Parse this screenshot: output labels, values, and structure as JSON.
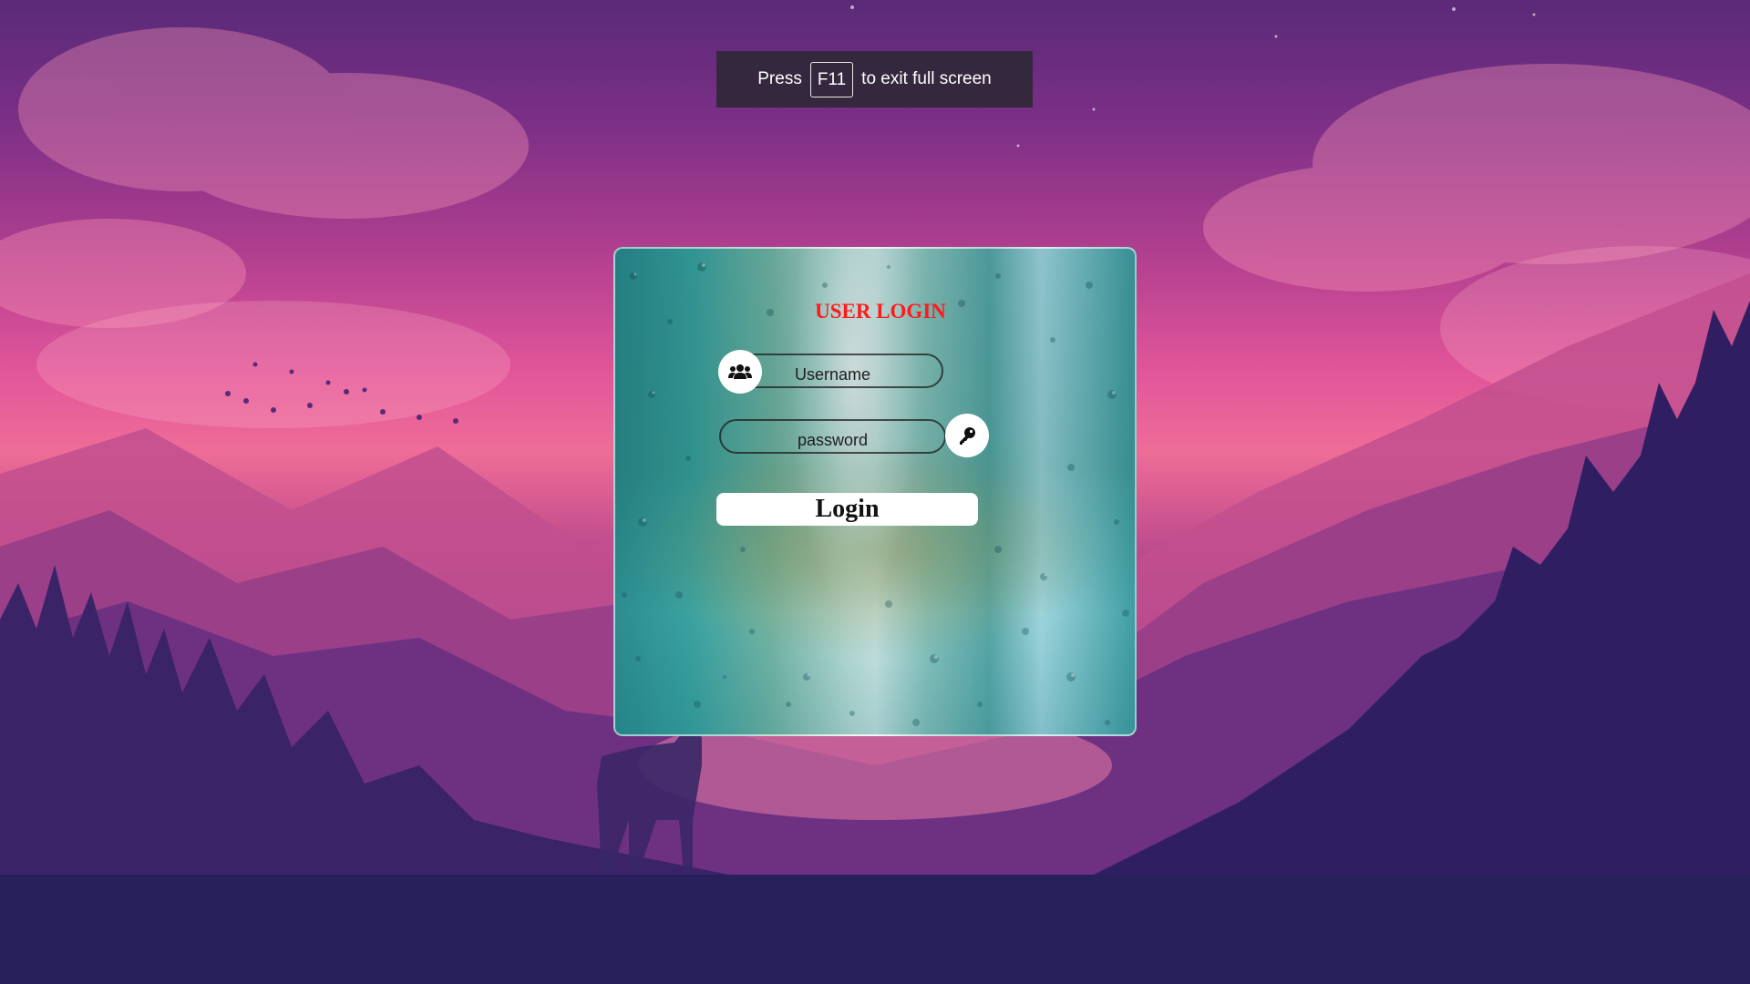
{
  "fullscreen_notice": {
    "prefix": "Press",
    "key": "F11",
    "suffix": "to exit full screen"
  },
  "login_card": {
    "title": "USER LOGIN",
    "title_color": "#ff1a1a",
    "username_placeholder": "Username",
    "password_placeholder": "password",
    "login_label": "Login",
    "username_icon": "users-icon",
    "password_icon": "key-icon"
  }
}
